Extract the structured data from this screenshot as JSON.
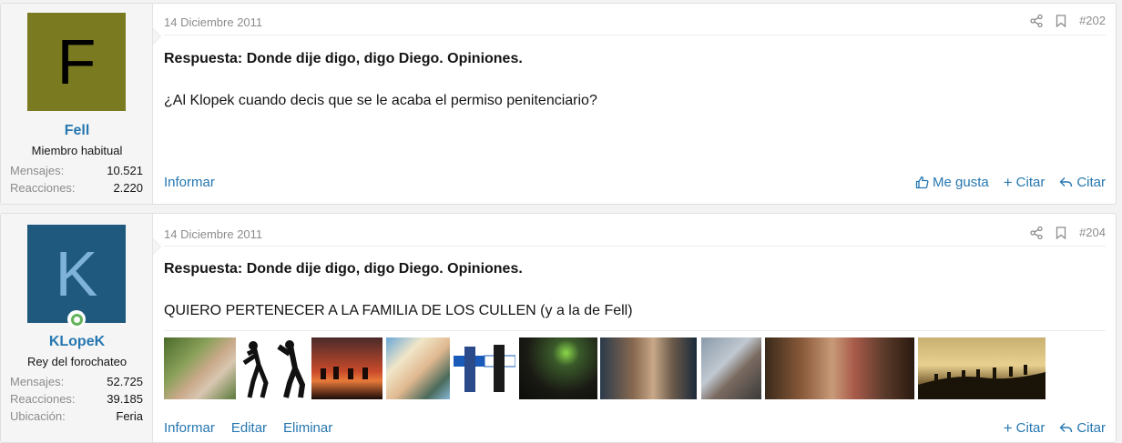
{
  "posts": [
    {
      "avatar_letter": "F",
      "avatar_bg": "#7a7b20",
      "avatar_fg": "#000000",
      "username": "Fell",
      "user_title": "Miembro habitual",
      "stats": [
        {
          "label": "Mensajes:",
          "value": "10.521"
        },
        {
          "label": "Reacciones:",
          "value": "2.220"
        }
      ],
      "date": "14 Diciembre 2011",
      "post_number": "#202",
      "title": "Respuesta: Donde dije digo, digo Diego. Opiniones.",
      "text": "¿Al Klopek cuando decis que se le acaba el permiso penitenciario?",
      "left_actions": [
        "Informar"
      ],
      "right_actions": [
        "Me gusta",
        "Citar",
        "Citar"
      ]
    },
    {
      "avatar_letter": "K",
      "avatar_bg": "#1f5a7e",
      "avatar_fg": "#7fb2d8",
      "username": "KLopeK",
      "user_title": "Rey del forochateo",
      "stats": [
        {
          "label": "Mensajes:",
          "value": "52.725"
        },
        {
          "label": "Reacciones:",
          "value": "39.185"
        },
        {
          "label": "Ubicación:",
          "value": "Feria"
        }
      ],
      "date": "14 Diciembre 2011",
      "post_number": "#204",
      "title": "Respuesta: Donde dije digo, digo Diego. Opiniones.",
      "text": "QUIERO PERTENECER A LA FAMILIA DE LOS CULLEN (y a la de Fell)",
      "left_actions": [
        "Informar",
        "Editar",
        "Eliminar"
      ],
      "right_actions": [
        "Citar",
        "Citar"
      ]
    }
  ],
  "colors": {
    "link": "#2577b1",
    "muted": "#8c8c8c",
    "online": "#63b35a"
  },
  "gallery": [
    {
      "name": "thumb-couple-forest"
    },
    {
      "name": "thumb-dancers-white"
    },
    {
      "name": "thumb-riders-sunset"
    },
    {
      "name": "thumb-comic-soldiers"
    },
    {
      "name": "thumb-movie-poster"
    },
    {
      "name": "thumb-green-lights"
    },
    {
      "name": "thumb-girl-portrait"
    },
    {
      "name": "thumb-woman-portrait"
    },
    {
      "name": "thumb-statue"
    },
    {
      "name": "thumb-dark-scene"
    },
    {
      "name": "thumb-silhouette-procession"
    }
  ]
}
